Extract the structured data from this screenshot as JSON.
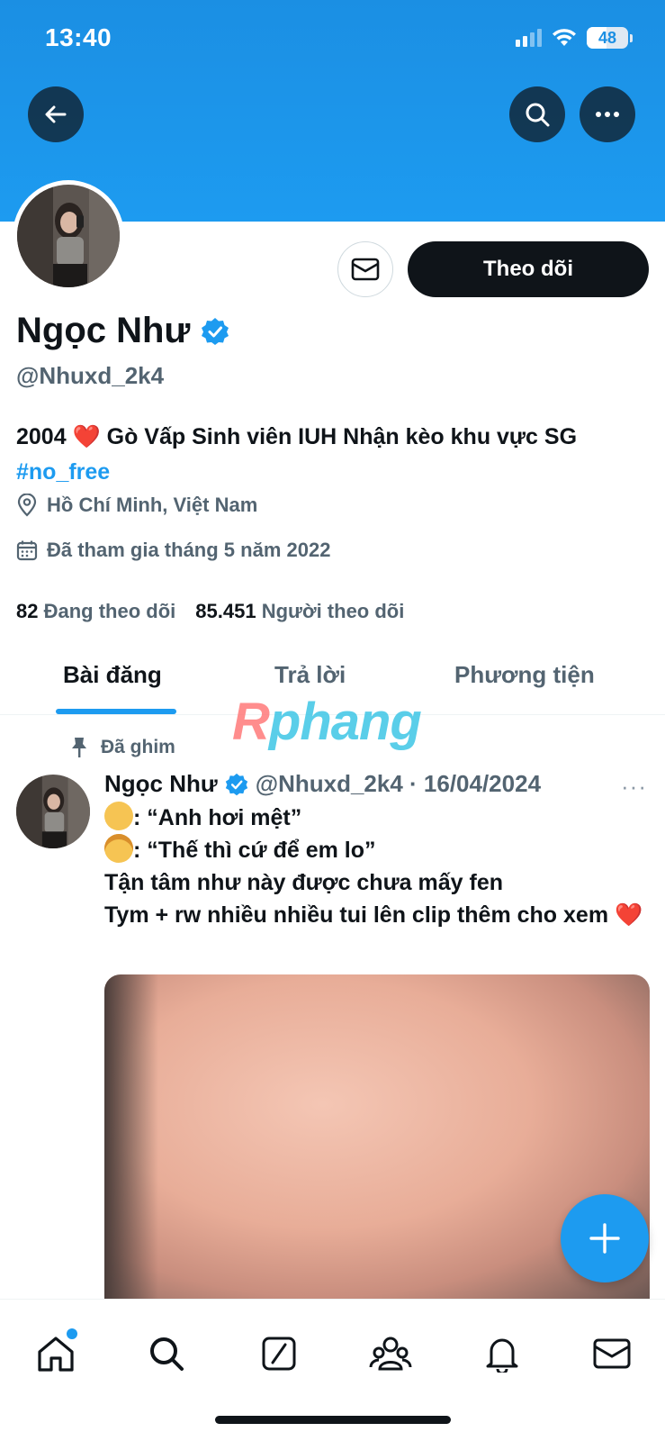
{
  "status_bar": {
    "time": "13:40",
    "battery": "48"
  },
  "profile": {
    "name": "Ngọc Như",
    "handle": "@Nhuxd_2k4",
    "bio": "2004 ❤️ Gò Vấp Sinh viên IUH Nhận kèo khu vực SG",
    "hashtag": "#no_free",
    "location": "Hồ Chí Minh, Việt Nam",
    "joined": "Đã tham gia tháng 5 năm 2022",
    "following_count": "82",
    "following_label": "Đang theo dõi",
    "followers_count": "85.451",
    "followers_label": "Người theo dõi",
    "follow_button": "Theo dõi"
  },
  "tabs": [
    {
      "label": "Bài đăng"
    },
    {
      "label": "Trả lời"
    },
    {
      "label": "Phương tiện"
    }
  ],
  "watermark": {
    "first": "R",
    "rest": "phang"
  },
  "post": {
    "pinned_label": "Đã ghim",
    "author": "Ngọc Như",
    "meta": "@Nhuxd_2k4 · 16/04/2024",
    "more": "···",
    "line1": ": “Anh hơi mệt”",
    "line2": ": “Thế thì cứ để em lo”",
    "line3": "Tận tâm như này được chưa mấy fen",
    "line4": "Tym + rw nhiều nhiều tui lên clip thêm cho xem",
    "heart": "❤️"
  },
  "colors": {
    "accent": "#1d9bf0",
    "banner": "#1b8fe3",
    "text": "#0f1419",
    "secondary": "#536471"
  },
  "icons": {
    "back": "arrow-left-icon",
    "search": "search-icon",
    "more": "more-icon",
    "message": "envelope-icon",
    "verified": "verified-badge-icon",
    "location": "location-pin-icon",
    "calendar": "calendar-icon",
    "pin": "pin-icon",
    "compose": "plus-icon",
    "nav": [
      "home-icon",
      "search-icon",
      "grok-icon",
      "communities-icon",
      "bell-icon",
      "envelope-icon"
    ]
  }
}
